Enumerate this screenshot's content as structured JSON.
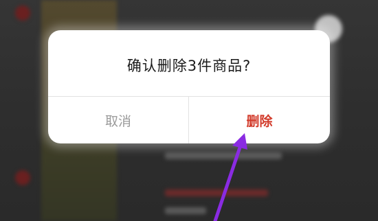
{
  "dialog": {
    "title": "确认删除3件商品?",
    "cancel_label": "取消",
    "delete_label": "删除"
  },
  "colors": {
    "delete_text": "#d23a2a",
    "cancel_text": "#9a9a9a",
    "arrow": "#8a2be2",
    "overlay": "#2e2e2e"
  }
}
